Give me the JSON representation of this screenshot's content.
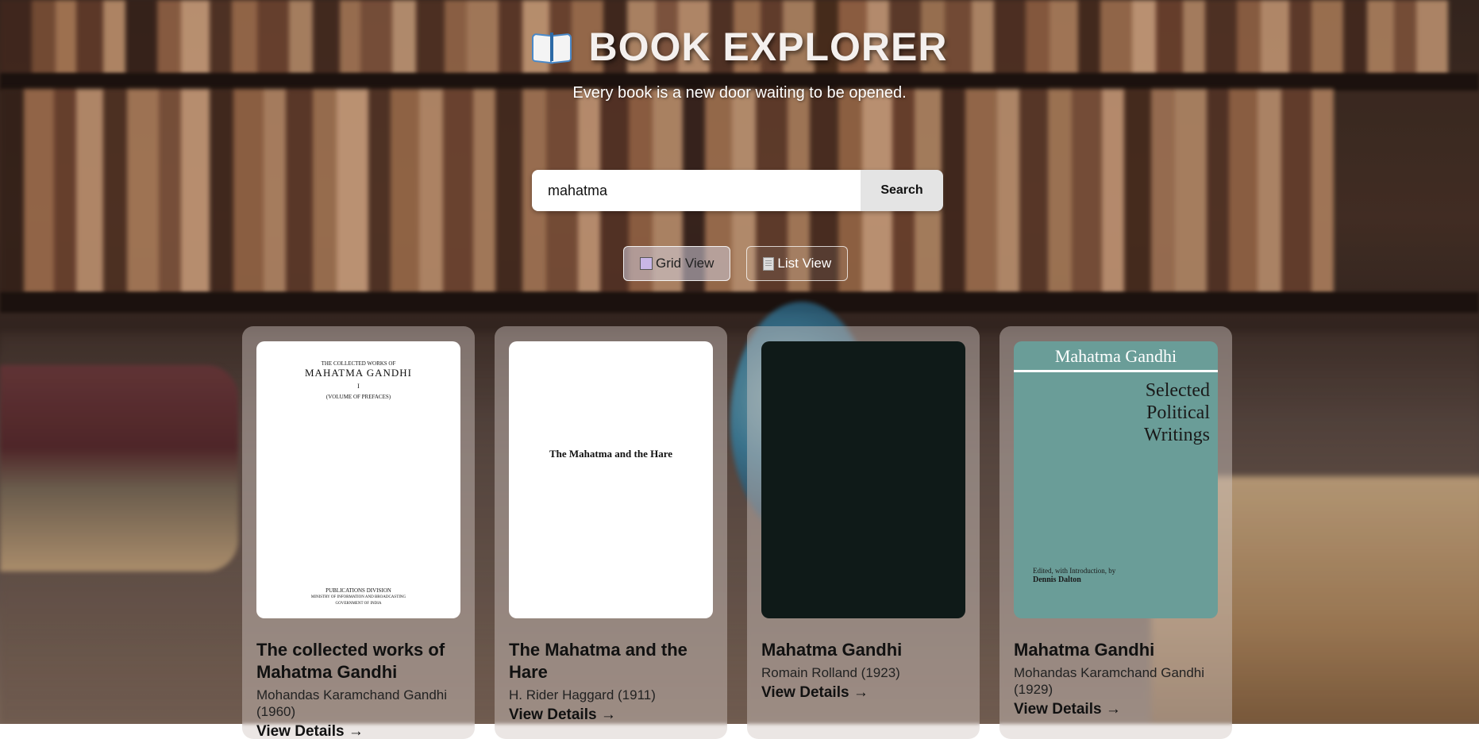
{
  "header": {
    "title": "BOOK EXPLORER",
    "tagline": "Every book is a new door waiting to be opened."
  },
  "search": {
    "value": "mahatma",
    "button_label": "Search"
  },
  "view_toggle": {
    "grid_label": "Grid View",
    "list_label": "List View",
    "active": "grid"
  },
  "books": [
    {
      "title": "The collected works of Mahatma Gandhi",
      "author": "Mohandas Karamchand Gandhi (1960)",
      "link": "View Details →",
      "cover_lines": [
        "THE COLLECTED WORKS OF",
        "MAHATMA GANDHI",
        "I",
        "(VOLUME OF PREFACES)",
        "PUBLICATIONS DIVISION",
        "MINISTRY OF INFORMATION AND BROADCASTING",
        "GOVERNMENT OF INDIA"
      ]
    },
    {
      "title": "The Mahatma and the Hare",
      "author": "H. Rider Haggard (1911)",
      "link": "View Details →",
      "cover_lines": [
        "The Mahatma and the Hare"
      ]
    },
    {
      "title": "Mahatma Gandhi",
      "author": "Romain Rolland (1923)",
      "link": "View Details →",
      "cover_lines": []
    },
    {
      "title": "Mahatma Gandhi",
      "author": "Mohandas Karamchand Gandhi (1929)",
      "link": "View Details →",
      "cover_lines": [
        "Mahatma Gandhi",
        "Selected",
        "Political",
        "Writings",
        "Edited, with Introduction, by",
        "Dennis Dalton"
      ]
    }
  ]
}
